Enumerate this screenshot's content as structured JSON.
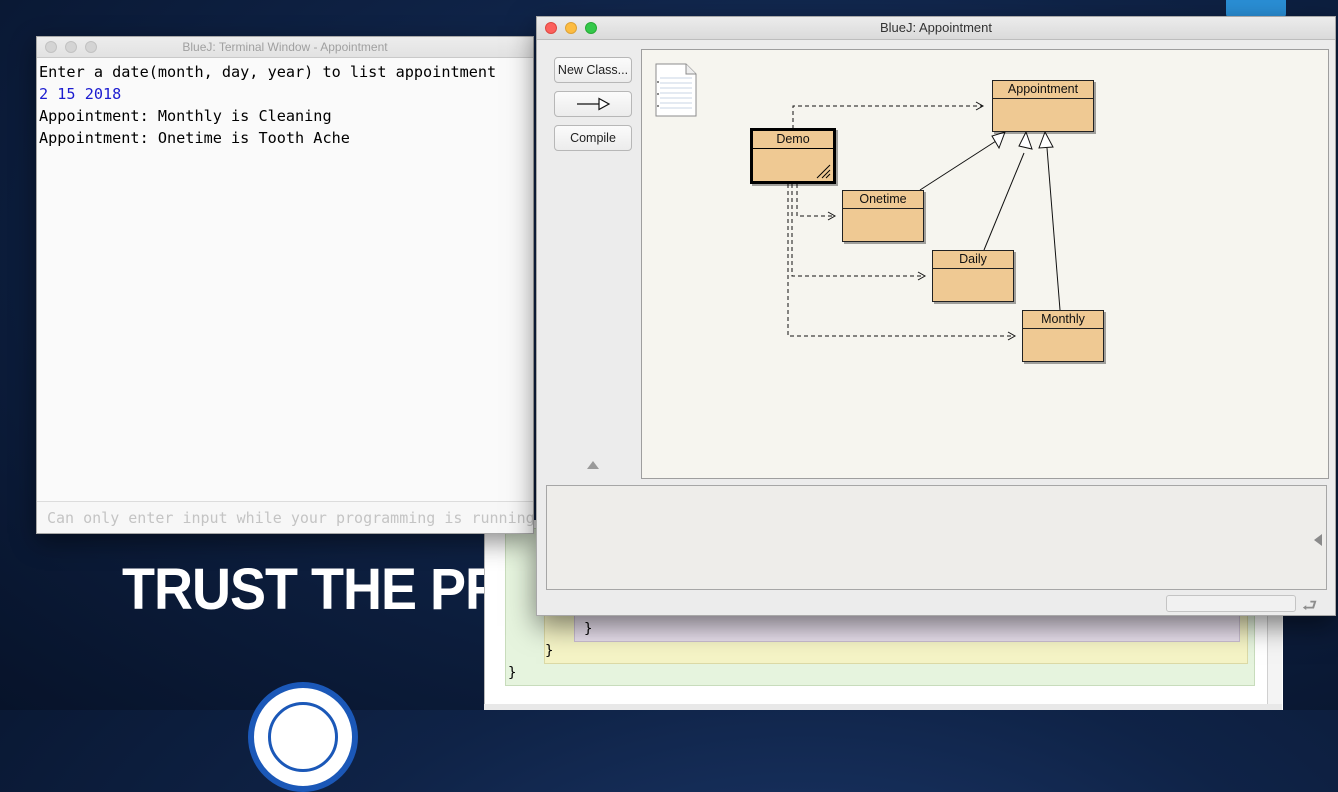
{
  "wallpaper": {
    "slogan": "TRUST THE PROCESS"
  },
  "editor": {
    "brace_inner": "}",
    "brace_middle": "}",
    "brace_outer": "}"
  },
  "terminal": {
    "title": "BlueJ: Terminal Window - Appointment",
    "lines": [
      "Enter a date(month, day, year) to list appointment",
      "2 15 2018",
      "Appointment: Monthly is Cleaning",
      "Appointment: Onetime is Tooth Ache"
    ],
    "input_placeholder": "Can only enter input while your programming is running"
  },
  "project": {
    "title": "BlueJ:  Appointment",
    "buttons": {
      "new_class": "New Class...",
      "inherit_arrow_icon": "inherits-arrow-icon",
      "compile": "Compile"
    },
    "classes": {
      "appointment": "Appointment",
      "demo": "Demo",
      "onetime": "Onetime",
      "daily": "Daily",
      "monthly": "Monthly"
    },
    "message_area": ""
  },
  "colors": {
    "class_fill": "#efc993",
    "input_echo": "#1c1cd0",
    "canvas_bg": "#f6f5ef"
  }
}
